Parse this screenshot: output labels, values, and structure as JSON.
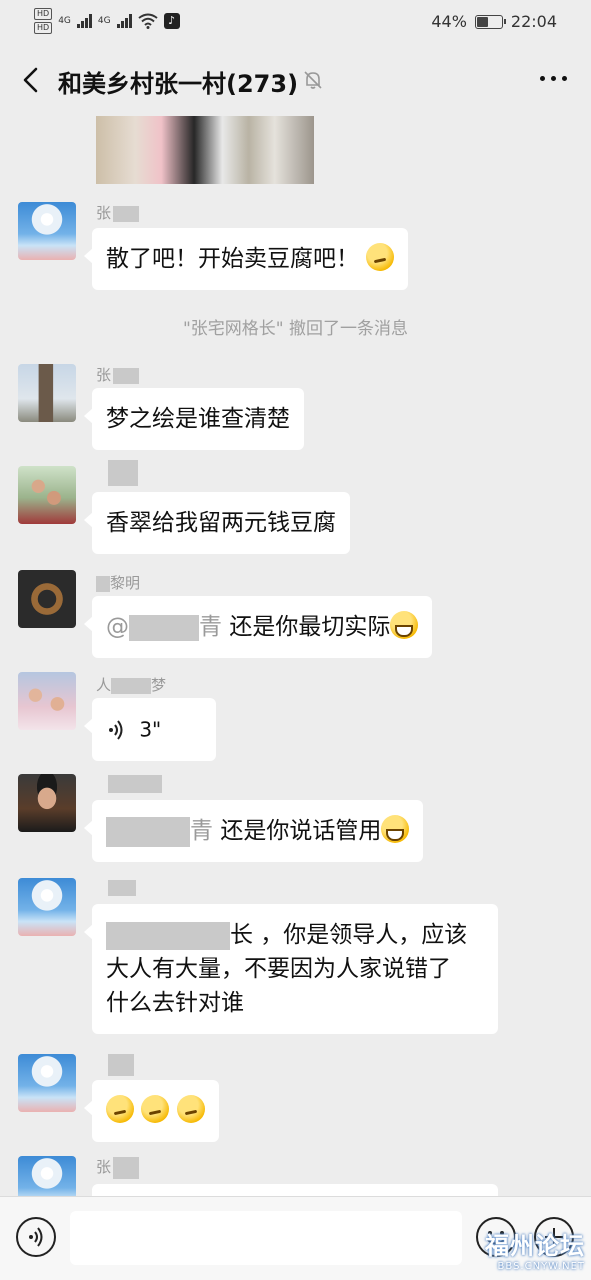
{
  "status_bar": {
    "hd1": "HD",
    "hd2": "HD",
    "net1": "4G",
    "net2": "4G",
    "battery_text": "44%",
    "battery_level": 0.44,
    "time": "22:04"
  },
  "header": {
    "title": "和美乡村张一村(273)"
  },
  "messages": [
    {
      "sender": "张",
      "text": "散了吧！开始卖豆腐吧！"
    },
    {
      "system": "\"张宅网格长\" 撤回了一条消息"
    },
    {
      "sender": "张",
      "text": "梦之绘是谁查清楚"
    },
    {
      "text": "香翠给我留两元钱豆腐"
    },
    {
      "sender": "黎明",
      "mention": "@",
      "mention_tail": "青",
      "text": "还是你最切实际"
    },
    {
      "sender": "人",
      "sender_tail": "梦",
      "voice_len": "3\""
    },
    {
      "mention_tail": "青",
      "text": "还是你说话管用"
    },
    {
      "line1_tail": "长 ，你是领导人，应该",
      "line2": "大人有大量，不要因为人家说错了",
      "line3": "什么去针对谁"
    },
    {},
    {
      "sender": "张"
    }
  ],
  "input": {
    "placeholder": ""
  },
  "watermark": {
    "main": "福州论坛",
    "sub": "BBS.CNYW.NET"
  },
  "colors": {
    "background": "#ededed",
    "bubble": "#ffffff",
    "system_text": "#a0a0a0"
  }
}
